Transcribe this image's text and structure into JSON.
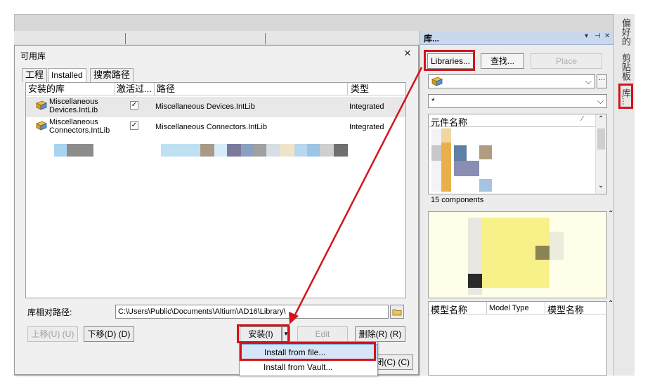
{
  "dialog": {
    "title": "可用库",
    "close_glyph": "×",
    "tabs": [
      "工程",
      "Installed",
      "搜索路径"
    ],
    "columns": [
      "安装的库",
      "激活过...",
      "路径",
      "类型"
    ],
    "rows": [
      {
        "name": "Miscellaneous Devices.IntLib",
        "active": true,
        "path": "Miscellaneous Devices.IntLib",
        "type": "Integrated"
      },
      {
        "name": "Miscellaneous Connectors.IntLib",
        "active": true,
        "path": "Miscellaneous Connectors.IntLib",
        "type": "Integrated"
      }
    ],
    "relative_path_label": "库相对路径:",
    "relative_path_value": "C:\\Users\\Public\\Documents\\Altium\\AD16\\Library\\",
    "buttons": {
      "move_up": "上移(U) (U)",
      "move_down": "下移(D) (D)",
      "install": "安装(I) (I)...",
      "edit": "Edit",
      "remove": "删除(R) (R)",
      "close": "闭(C) (C)"
    },
    "install_menu": [
      "Install from file...",
      "Install from Vault..."
    ]
  },
  "library_panel": {
    "title": "库...",
    "controls": [
      "▾",
      "⊣",
      "✕"
    ],
    "libraries_button": "Libraries...",
    "search_button": "查找...",
    "place_button": "Place",
    "filter_value": "*",
    "component_header": "元件名称",
    "component_count": "15 components",
    "model_headers": [
      "模型名称",
      "Model Type",
      "模型名称"
    ]
  },
  "side_tabs": [
    "偏好的",
    "剪贴板",
    "库..."
  ],
  "colors": {
    "highlight_red": "#d3141c",
    "panel_header": "#c9d8ec",
    "preview_bg": "#fffee8"
  }
}
